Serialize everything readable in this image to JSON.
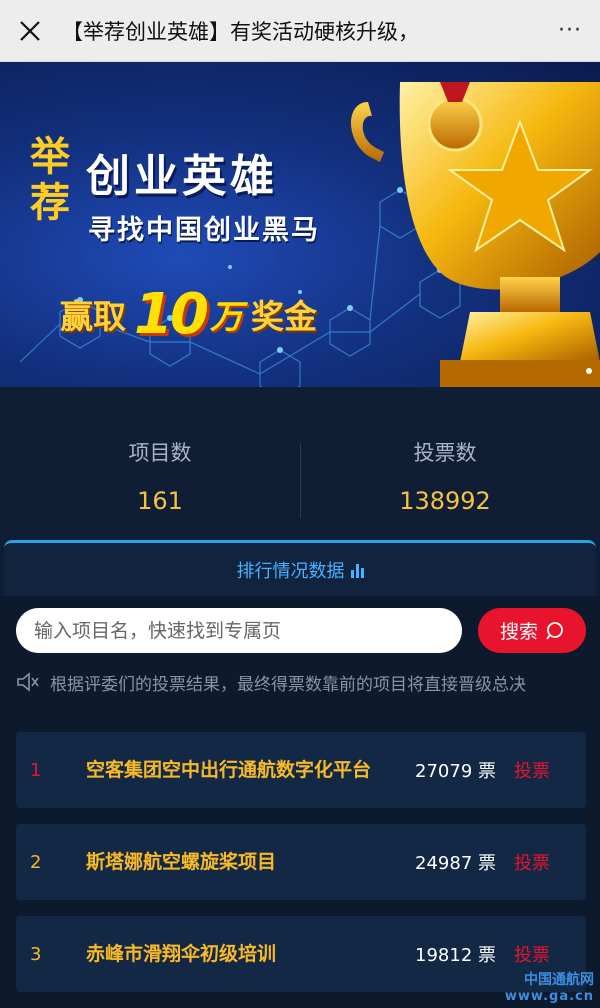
{
  "topbar": {
    "title": "【举荐创业英雄】有奖活动硬核升级，",
    "more": "···"
  },
  "banner": {
    "jt_chars": [
      "举",
      "荐"
    ],
    "title": "创业英雄",
    "subtitle": "寻找中国创业黑马",
    "prize_prefix": "赢取",
    "prize_number": "10",
    "prize_unit": "万",
    "prize_suffix": "奖金"
  },
  "stats": {
    "projects_label": "项目数",
    "projects_value": "161",
    "votes_label": "投票数",
    "votes_value": "138992"
  },
  "tab": {
    "label": "排行情况数据"
  },
  "search": {
    "placeholder": "输入项目名，快速找到专属页",
    "button_label": "搜索"
  },
  "notice": {
    "text": "根据评委们的投票结果，最终得票数靠前的项目将直接晋级总决"
  },
  "ranking": [
    {
      "rank": "1",
      "name": "空客集团空中出行通航数字化平台",
      "votes": "27079 票",
      "action": "投票"
    },
    {
      "rank": "2",
      "name": "斯塔娜航空螺旋桨项目",
      "votes": "24987 票",
      "action": "投票"
    },
    {
      "rank": "3",
      "name": "赤峰市滑翔伞初级培训",
      "votes": "19812 票",
      "action": "投票"
    }
  ],
  "colors": {
    "rank1": "#e8142e",
    "rank_other": "#f7b928",
    "accent_blue": "#45b3ff",
    "vote_red": "#e8142e"
  },
  "watermark": {
    "name": "中国通航网",
    "url": "www.ga.cn"
  }
}
